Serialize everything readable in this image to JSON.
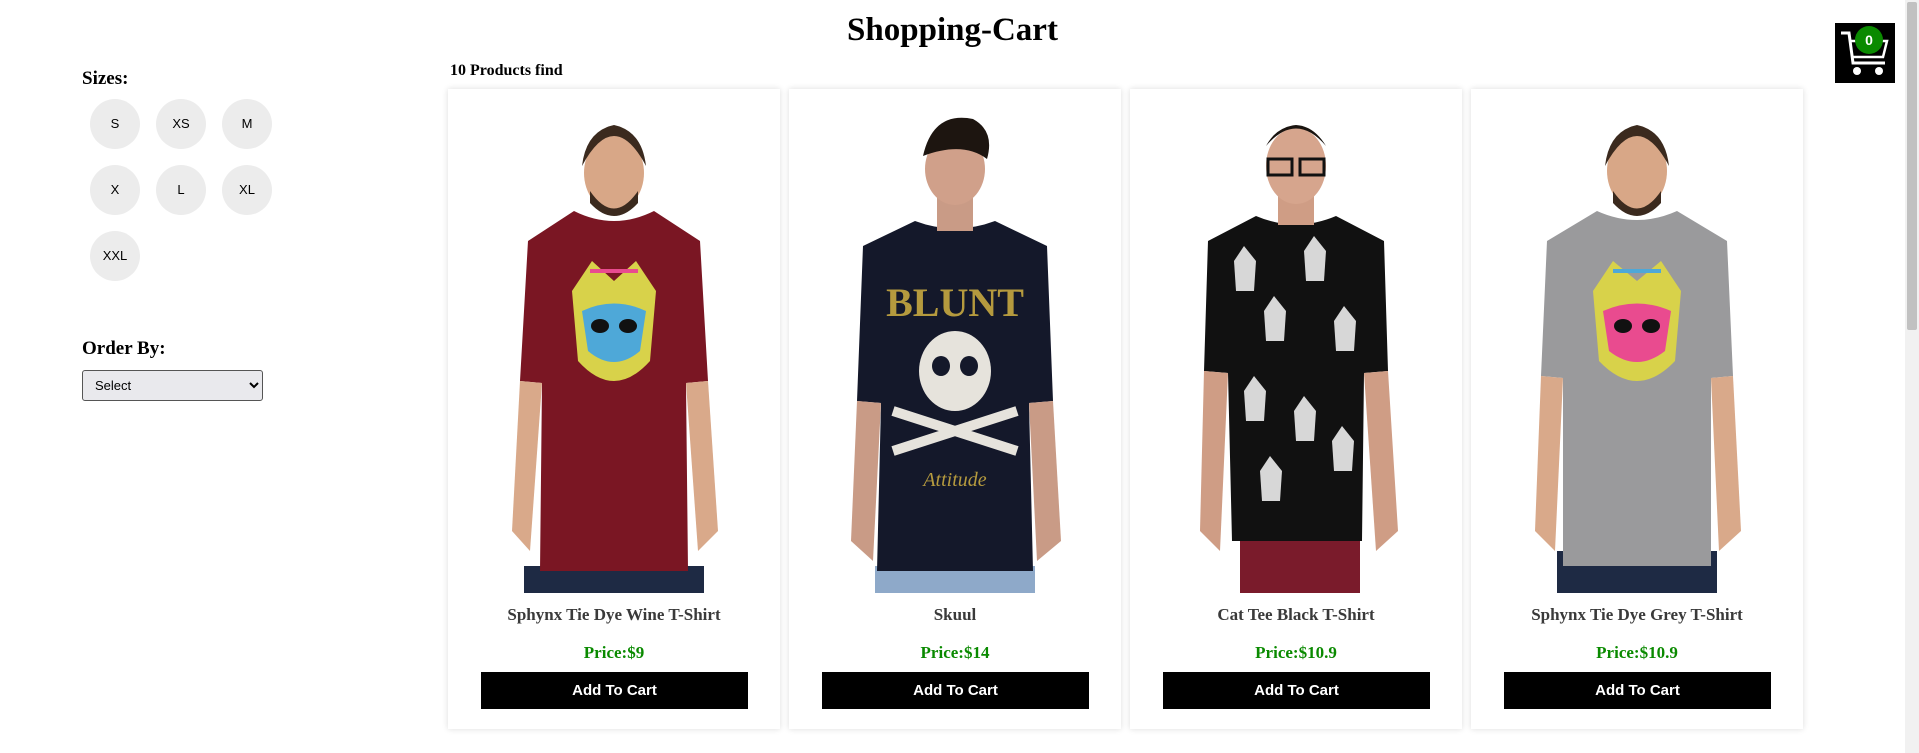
{
  "header": {
    "title": "Shopping-Cart"
  },
  "cart": {
    "count": "0",
    "icon": "shopping-cart-icon"
  },
  "filters": {
    "sizes_title": "Sizes:",
    "sizes": [
      "S",
      "XS",
      "M",
      "X",
      "L",
      "XL",
      "XXL"
    ],
    "order_title": "Order By:",
    "order_selected": "Select"
  },
  "results": {
    "count_text": "10 Products find"
  },
  "colors": {
    "accent_green": "#0a8a00",
    "button_black": "#000000"
  },
  "products": [
    {
      "name": "Sphynx Tie Dye Wine T-Shirt",
      "price": "Price:$9",
      "button": "Add To Cart",
      "shirt_color": "#7a1623",
      "print": "cat"
    },
    {
      "name": "Skuul",
      "price": "Price:$14",
      "button": "Add To Cart",
      "shirt_color": "#14182a",
      "print": "skull"
    },
    {
      "name": "Cat Tee Black T-Shirt",
      "price": "Price:$10.9",
      "button": "Add To Cart",
      "shirt_color": "#111111",
      "print": "cats-pattern"
    },
    {
      "name": "Sphynx Tie Dye Grey T-Shirt",
      "price": "Price:$10.9",
      "button": "Add To Cart",
      "shirt_color": "#9a9a9c",
      "print": "cat"
    }
  ]
}
